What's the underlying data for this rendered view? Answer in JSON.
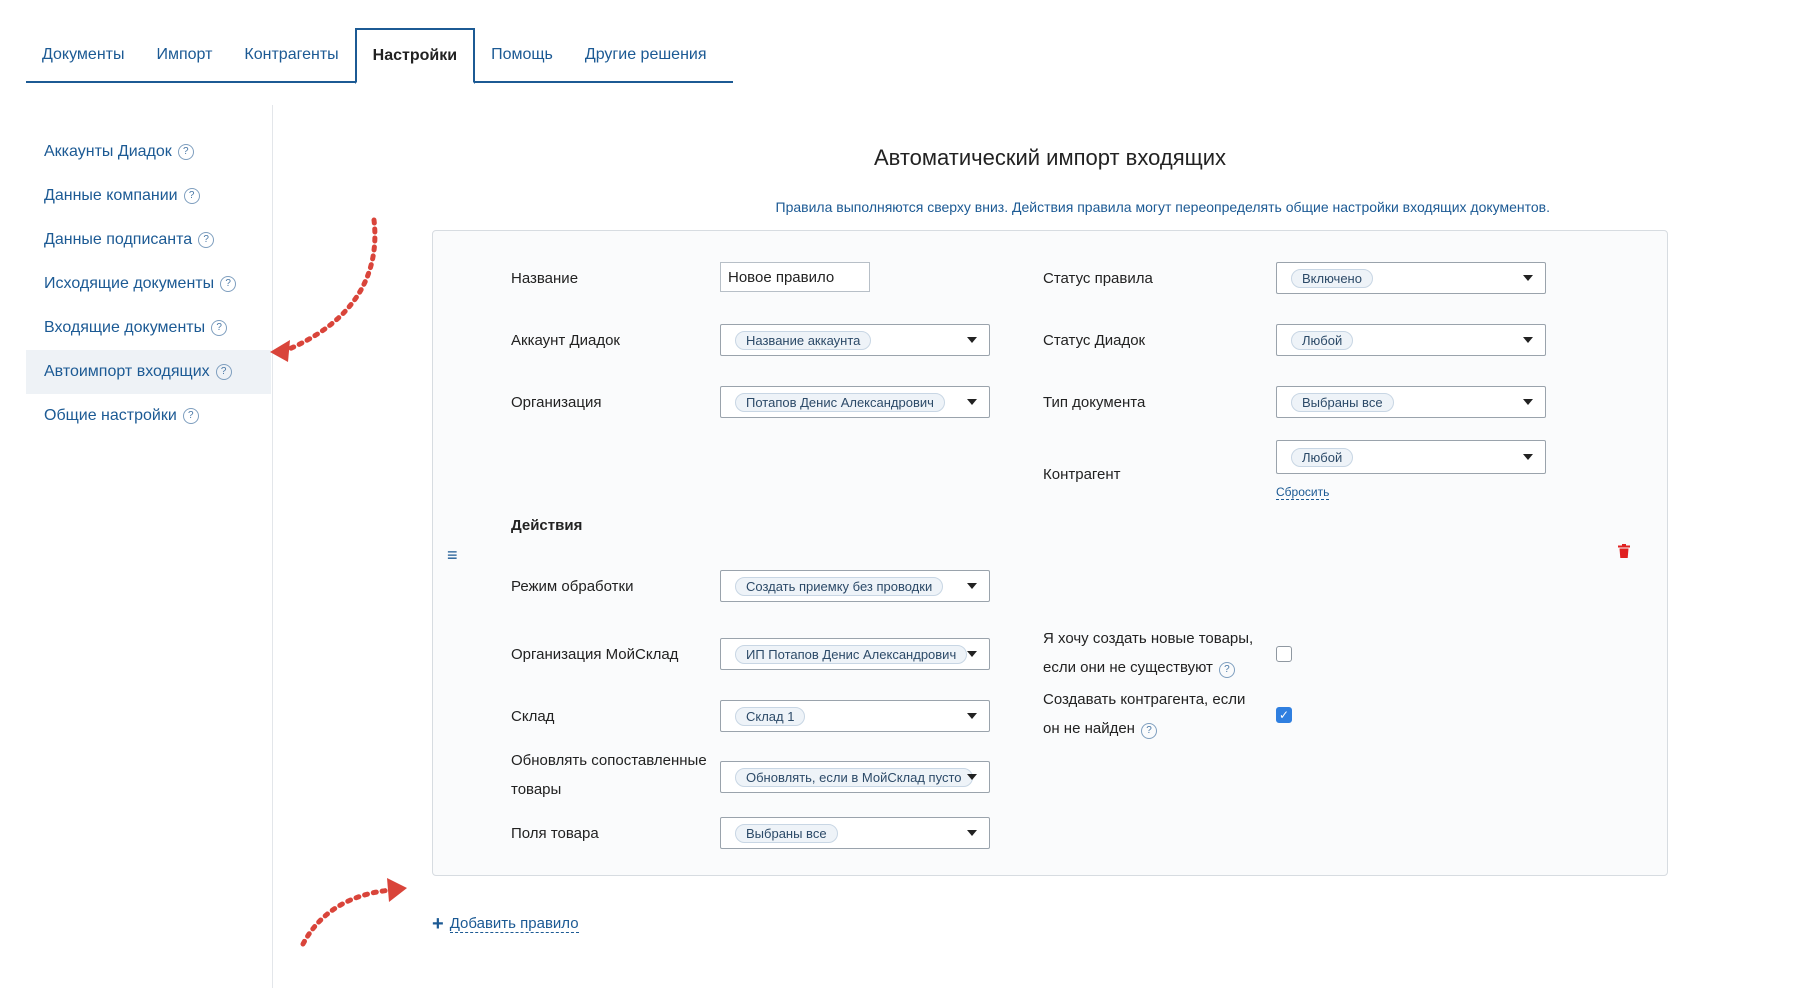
{
  "tabs": [
    {
      "label": "Документы"
    },
    {
      "label": "Импорт"
    },
    {
      "label": "Контрагенты"
    },
    {
      "label": "Настройки"
    },
    {
      "label": "Помощь"
    },
    {
      "label": "Другие решения"
    }
  ],
  "sidebar": {
    "items": [
      {
        "label": "Аккаунты Диадок"
      },
      {
        "label": "Данные компании"
      },
      {
        "label": "Данные подписанта"
      },
      {
        "label": "Исходящие документы"
      },
      {
        "label": "Входящие документы"
      },
      {
        "label": "Автоимпорт входящих"
      },
      {
        "label": "Общие настройки"
      }
    ],
    "help_glyph": "?"
  },
  "main": {
    "title": "Автоматический импорт входящих",
    "subtitle": "Правила выполняются сверху вниз. Действия правила могут переопределять общие настройки входящих документов."
  },
  "rule": {
    "name_label": "Название",
    "name_value": "Новое правило",
    "account_label": "Аккаунт Диадок",
    "account_value": "Название аккаунта",
    "org_label": "Организация",
    "org_value": "Потапов Денис Александрович",
    "rule_status_label": "Статус правила",
    "rule_status_value": "Включено",
    "diadoc_status_label": "Статус Диадок",
    "diadoc_status_value": "Любой",
    "doc_type_label": "Тип документа",
    "doc_type_value": "Выбраны все",
    "counterparty_label": "Контрагент",
    "counterparty_value": "Любой",
    "reset_link": "Сбросить",
    "actions_heading": "Действия",
    "mode_label": "Режим обработки",
    "mode_value": "Создать приемку без проводки",
    "ms_org_label": "Организация МойСклад",
    "ms_org_value": "ИП Потапов Денис Александрович",
    "warehouse_label": "Склад",
    "warehouse_value": "Склад 1",
    "update_label_1": "Обновлять сопоставленные",
    "update_label_2": "товары",
    "update_value": "Обновлять, если в МойСклад пусто",
    "fields_label": "Поля товара",
    "fields_value": "Выбраны все",
    "create_goods_label_1": "Я хочу создать новые товары,",
    "create_goods_label_2": "если они не существуют",
    "create_goods_checked": false,
    "create_cp_label_1": "Создавать контрагента, если",
    "create_cp_label_2": "он не найден",
    "create_cp_checked": true,
    "handle_glyph": "≡"
  },
  "add_rule": {
    "plus": "+",
    "label": "Добавить правило"
  },
  "colors": {
    "accent": "#1c5a94",
    "trash": "#e02020",
    "checkbox": "#2f7fe0",
    "arrow": "#d9443a"
  },
  "icons": {
    "trash": "trash-icon",
    "drag": "drag-handle-icon",
    "caret": "caret-down-icon"
  }
}
